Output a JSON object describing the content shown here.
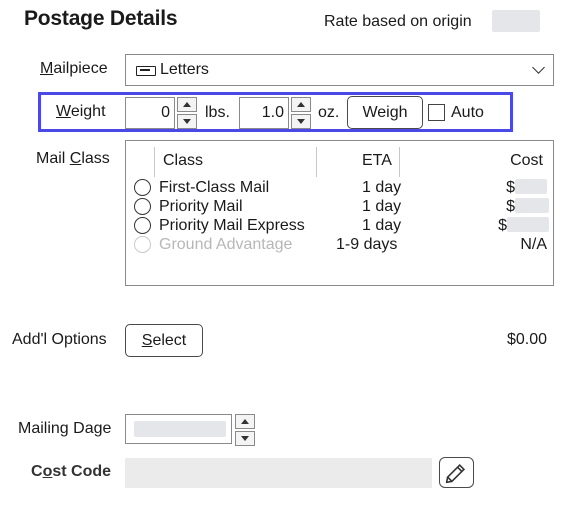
{
  "header": {
    "title": "Postage Details",
    "rate_label": "Rate based on origin"
  },
  "mailpiece": {
    "label": "Mailpiece",
    "value": "Letters",
    "icon": "envelope-icon"
  },
  "weight": {
    "label": "Weight",
    "lbs_value": "0",
    "lbs_unit": "lbs.",
    "oz_value": "1.0",
    "oz_unit": "oz.",
    "weigh_button": "Weigh",
    "auto_label": "Auto",
    "highlight_color": "#4a48e6"
  },
  "mail_class": {
    "label": "Mail Class",
    "columns": {
      "class": "Class",
      "eta": "ETA",
      "cost": "Cost"
    },
    "rows": [
      {
        "name": "First-Class Mail",
        "eta": "1 day",
        "cost": "$"
      },
      {
        "name": "Priority Mail",
        "eta": "1 day",
        "cost": "$"
      },
      {
        "name": "Priority Mail Express",
        "eta": "1 day",
        "cost": "$"
      },
      {
        "name": "Ground Advantage",
        "eta": "1-9 days",
        "cost": "N/A"
      }
    ]
  },
  "options": {
    "label": "Add'l Options",
    "select_button": "Select",
    "amount": "$0.00"
  },
  "mailing_date": {
    "label": "Mailing Date"
  },
  "cost_code": {
    "label": "Cost Code",
    "edit_icon": "pencil-icon"
  }
}
